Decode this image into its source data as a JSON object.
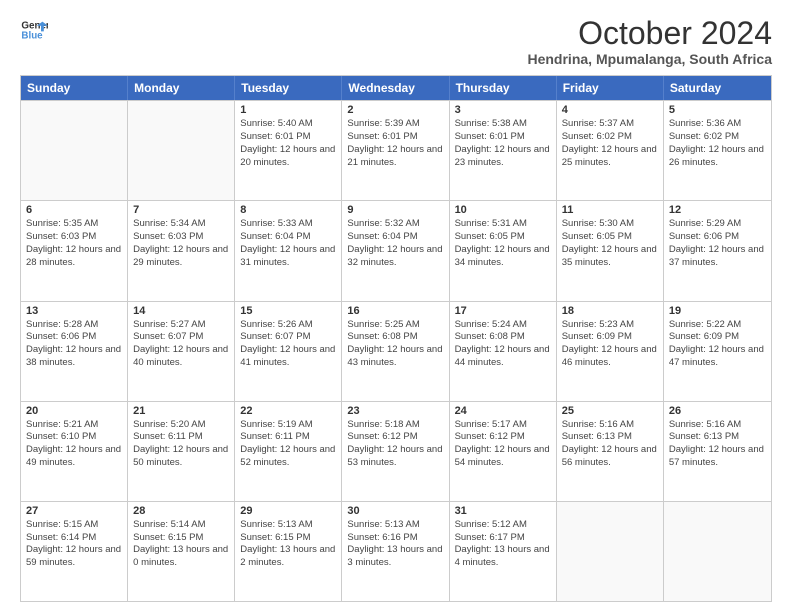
{
  "logo": {
    "line1": "General",
    "line2": "Blue"
  },
  "title": "October 2024",
  "subtitle": "Hendrina, Mpumalanga, South Africa",
  "headers": [
    "Sunday",
    "Monday",
    "Tuesday",
    "Wednesday",
    "Thursday",
    "Friday",
    "Saturday"
  ],
  "rows": [
    [
      {
        "day": "",
        "sunrise": "",
        "sunset": "",
        "daylight": ""
      },
      {
        "day": "",
        "sunrise": "",
        "sunset": "",
        "daylight": ""
      },
      {
        "day": "1",
        "sunrise": "Sunrise: 5:40 AM",
        "sunset": "Sunset: 6:01 PM",
        "daylight": "Daylight: 12 hours and 20 minutes."
      },
      {
        "day": "2",
        "sunrise": "Sunrise: 5:39 AM",
        "sunset": "Sunset: 6:01 PM",
        "daylight": "Daylight: 12 hours and 21 minutes."
      },
      {
        "day": "3",
        "sunrise": "Sunrise: 5:38 AM",
        "sunset": "Sunset: 6:01 PM",
        "daylight": "Daylight: 12 hours and 23 minutes."
      },
      {
        "day": "4",
        "sunrise": "Sunrise: 5:37 AM",
        "sunset": "Sunset: 6:02 PM",
        "daylight": "Daylight: 12 hours and 25 minutes."
      },
      {
        "day": "5",
        "sunrise": "Sunrise: 5:36 AM",
        "sunset": "Sunset: 6:02 PM",
        "daylight": "Daylight: 12 hours and 26 minutes."
      }
    ],
    [
      {
        "day": "6",
        "sunrise": "Sunrise: 5:35 AM",
        "sunset": "Sunset: 6:03 PM",
        "daylight": "Daylight: 12 hours and 28 minutes."
      },
      {
        "day": "7",
        "sunrise": "Sunrise: 5:34 AM",
        "sunset": "Sunset: 6:03 PM",
        "daylight": "Daylight: 12 hours and 29 minutes."
      },
      {
        "day": "8",
        "sunrise": "Sunrise: 5:33 AM",
        "sunset": "Sunset: 6:04 PM",
        "daylight": "Daylight: 12 hours and 31 minutes."
      },
      {
        "day": "9",
        "sunrise": "Sunrise: 5:32 AM",
        "sunset": "Sunset: 6:04 PM",
        "daylight": "Daylight: 12 hours and 32 minutes."
      },
      {
        "day": "10",
        "sunrise": "Sunrise: 5:31 AM",
        "sunset": "Sunset: 6:05 PM",
        "daylight": "Daylight: 12 hours and 34 minutes."
      },
      {
        "day": "11",
        "sunrise": "Sunrise: 5:30 AM",
        "sunset": "Sunset: 6:05 PM",
        "daylight": "Daylight: 12 hours and 35 minutes."
      },
      {
        "day": "12",
        "sunrise": "Sunrise: 5:29 AM",
        "sunset": "Sunset: 6:06 PM",
        "daylight": "Daylight: 12 hours and 37 minutes."
      }
    ],
    [
      {
        "day": "13",
        "sunrise": "Sunrise: 5:28 AM",
        "sunset": "Sunset: 6:06 PM",
        "daylight": "Daylight: 12 hours and 38 minutes."
      },
      {
        "day": "14",
        "sunrise": "Sunrise: 5:27 AM",
        "sunset": "Sunset: 6:07 PM",
        "daylight": "Daylight: 12 hours and 40 minutes."
      },
      {
        "day": "15",
        "sunrise": "Sunrise: 5:26 AM",
        "sunset": "Sunset: 6:07 PM",
        "daylight": "Daylight: 12 hours and 41 minutes."
      },
      {
        "day": "16",
        "sunrise": "Sunrise: 5:25 AM",
        "sunset": "Sunset: 6:08 PM",
        "daylight": "Daylight: 12 hours and 43 minutes."
      },
      {
        "day": "17",
        "sunrise": "Sunrise: 5:24 AM",
        "sunset": "Sunset: 6:08 PM",
        "daylight": "Daylight: 12 hours and 44 minutes."
      },
      {
        "day": "18",
        "sunrise": "Sunrise: 5:23 AM",
        "sunset": "Sunset: 6:09 PM",
        "daylight": "Daylight: 12 hours and 46 minutes."
      },
      {
        "day": "19",
        "sunrise": "Sunrise: 5:22 AM",
        "sunset": "Sunset: 6:09 PM",
        "daylight": "Daylight: 12 hours and 47 minutes."
      }
    ],
    [
      {
        "day": "20",
        "sunrise": "Sunrise: 5:21 AM",
        "sunset": "Sunset: 6:10 PM",
        "daylight": "Daylight: 12 hours and 49 minutes."
      },
      {
        "day": "21",
        "sunrise": "Sunrise: 5:20 AM",
        "sunset": "Sunset: 6:11 PM",
        "daylight": "Daylight: 12 hours and 50 minutes."
      },
      {
        "day": "22",
        "sunrise": "Sunrise: 5:19 AM",
        "sunset": "Sunset: 6:11 PM",
        "daylight": "Daylight: 12 hours and 52 minutes."
      },
      {
        "day": "23",
        "sunrise": "Sunrise: 5:18 AM",
        "sunset": "Sunset: 6:12 PM",
        "daylight": "Daylight: 12 hours and 53 minutes."
      },
      {
        "day": "24",
        "sunrise": "Sunrise: 5:17 AM",
        "sunset": "Sunset: 6:12 PM",
        "daylight": "Daylight: 12 hours and 54 minutes."
      },
      {
        "day": "25",
        "sunrise": "Sunrise: 5:16 AM",
        "sunset": "Sunset: 6:13 PM",
        "daylight": "Daylight: 12 hours and 56 minutes."
      },
      {
        "day": "26",
        "sunrise": "Sunrise: 5:16 AM",
        "sunset": "Sunset: 6:13 PM",
        "daylight": "Daylight: 12 hours and 57 minutes."
      }
    ],
    [
      {
        "day": "27",
        "sunrise": "Sunrise: 5:15 AM",
        "sunset": "Sunset: 6:14 PM",
        "daylight": "Daylight: 12 hours and 59 minutes."
      },
      {
        "day": "28",
        "sunrise": "Sunrise: 5:14 AM",
        "sunset": "Sunset: 6:15 PM",
        "daylight": "Daylight: 13 hours and 0 minutes."
      },
      {
        "day": "29",
        "sunrise": "Sunrise: 5:13 AM",
        "sunset": "Sunset: 6:15 PM",
        "daylight": "Daylight: 13 hours and 2 minutes."
      },
      {
        "day": "30",
        "sunrise": "Sunrise: 5:13 AM",
        "sunset": "Sunset: 6:16 PM",
        "daylight": "Daylight: 13 hours and 3 minutes."
      },
      {
        "day": "31",
        "sunrise": "Sunrise: 5:12 AM",
        "sunset": "Sunset: 6:17 PM",
        "daylight": "Daylight: 13 hours and 4 minutes."
      },
      {
        "day": "",
        "sunrise": "",
        "sunset": "",
        "daylight": ""
      },
      {
        "day": "",
        "sunrise": "",
        "sunset": "",
        "daylight": ""
      }
    ]
  ]
}
